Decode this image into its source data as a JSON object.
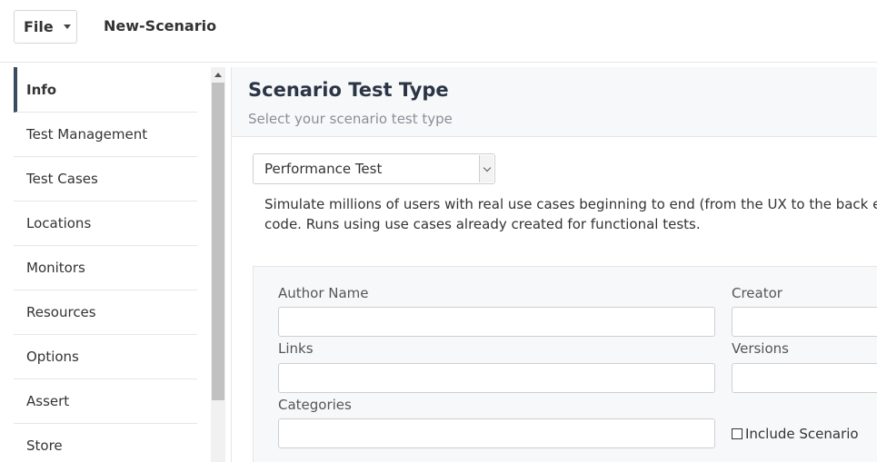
{
  "toolbar": {
    "file_label": "File",
    "scenario_name": "New-Scenario"
  },
  "sidebar": {
    "items": [
      {
        "label": "Info",
        "active": true
      },
      {
        "label": "Test Management"
      },
      {
        "label": "Test Cases"
      },
      {
        "label": "Locations"
      },
      {
        "label": "Monitors"
      },
      {
        "label": "Resources"
      },
      {
        "label": "Options"
      },
      {
        "label": "Assert"
      },
      {
        "label": "Store"
      }
    ]
  },
  "main": {
    "title": "Scenario Test Type",
    "subtitle": "Select your scenario test type",
    "test_type": {
      "selected": "Performance Test"
    },
    "description_line1": "Simulate millions of users with real use cases beginning to end (from the UX to the back end). Id",
    "description_line2": "code. Runs using use cases already created for functional tests.",
    "form": {
      "author_name_label": "Author Name",
      "author_name_value": "",
      "creator_label": "Creator",
      "creator_value": "",
      "links_label": "Links",
      "links_value": "",
      "versions_label": "Versions",
      "versions_value": "",
      "categories_label": "Categories",
      "categories_value": "",
      "include_scenario_label": "Include Scenario",
      "include_scenario_checked": false
    }
  },
  "colors": {
    "accent": "#3a4a5f",
    "border": "#e6e6e6",
    "panel_bg": "#f7f8fa"
  }
}
